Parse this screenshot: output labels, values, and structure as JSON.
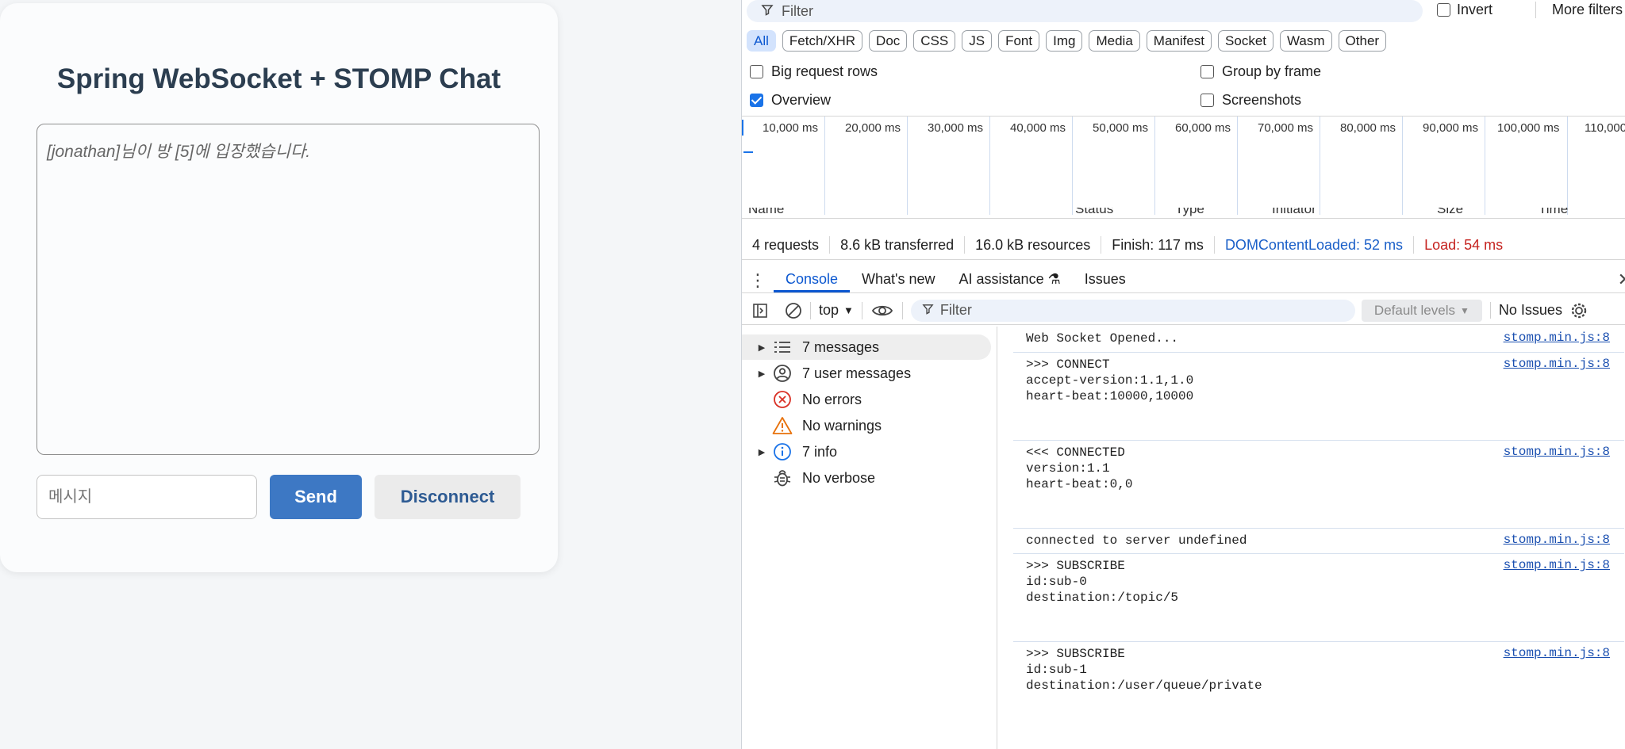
{
  "chat": {
    "title": "Spring WebSocket + STOMP Chat",
    "log_message": "[jonathan]님이 방 [5]에 입장했습니다.",
    "input_placeholder": "메시지",
    "send_label": "Send",
    "disconnect_label": "Disconnect"
  },
  "devtools": {
    "filter_placeholder": "Filter",
    "invert_label": "Invert",
    "more_filters_label": "More filters",
    "type_chips": [
      "All",
      "Fetch/XHR",
      "Doc",
      "CSS",
      "JS",
      "Font",
      "Img",
      "Media",
      "Manifest",
      "Socket",
      "Wasm",
      "Other"
    ],
    "options": {
      "big_request_rows": "Big request rows",
      "group_by_frame": "Group by frame",
      "overview": "Overview",
      "screenshots": "Screenshots"
    },
    "timeline_ticks": [
      "10,000 ms",
      "20,000 ms",
      "30,000 ms",
      "40,000 ms",
      "50,000 ms",
      "60,000 ms",
      "70,000 ms",
      "80,000 ms",
      "90,000 ms",
      "100,000 ms",
      "110,000"
    ],
    "columns": [
      "Name",
      "Status",
      "Type",
      "Initiator",
      "Size",
      "Time"
    ],
    "summary": {
      "requests": "4 requests",
      "transferred": "8.6 kB transferred",
      "resources": "16.0 kB resources",
      "finish": "Finish: 117 ms",
      "dom_content_loaded": "DOMContentLoaded: 52 ms",
      "load": "Load: 54 ms"
    },
    "drawer_tabs": [
      "Console",
      "What's new",
      "AI assistance",
      "Issues"
    ],
    "console_toolbar": {
      "context": "top",
      "filter_placeholder": "Filter",
      "levels": "Default levels",
      "issues": "No Issues"
    },
    "sidebar": [
      {
        "label": "7 messages",
        "icon": "list-icon"
      },
      {
        "label": "7 user messages",
        "icon": "user-icon"
      },
      {
        "label": "No errors",
        "icon": "error-icon"
      },
      {
        "label": "No warnings",
        "icon": "warning-icon"
      },
      {
        "label": "7 info",
        "icon": "info-icon"
      },
      {
        "label": "No verbose",
        "icon": "bug-icon"
      }
    ],
    "messages": [
      {
        "text": "Web Socket Opened...",
        "source": "stomp.min.js:8"
      },
      {
        "text": ">>> CONNECT\naccept-version:1.1,1.0\nheart-beat:10000,10000",
        "source": "stomp.min.js:8"
      },
      {
        "text": "<<< CONNECTED\nversion:1.1\nheart-beat:0,0",
        "source": "stomp.min.js:8"
      },
      {
        "text": "connected to server undefined",
        "source": "stomp.min.js:8"
      },
      {
        "text": ">>> SUBSCRIBE\nid:sub-0\ndestination:/topic/5",
        "source": "stomp.min.js:8"
      },
      {
        "text": ">>> SUBSCRIBE\nid:sub-1\ndestination:/user/queue/private",
        "source": "stomp.min.js:8"
      }
    ]
  }
}
